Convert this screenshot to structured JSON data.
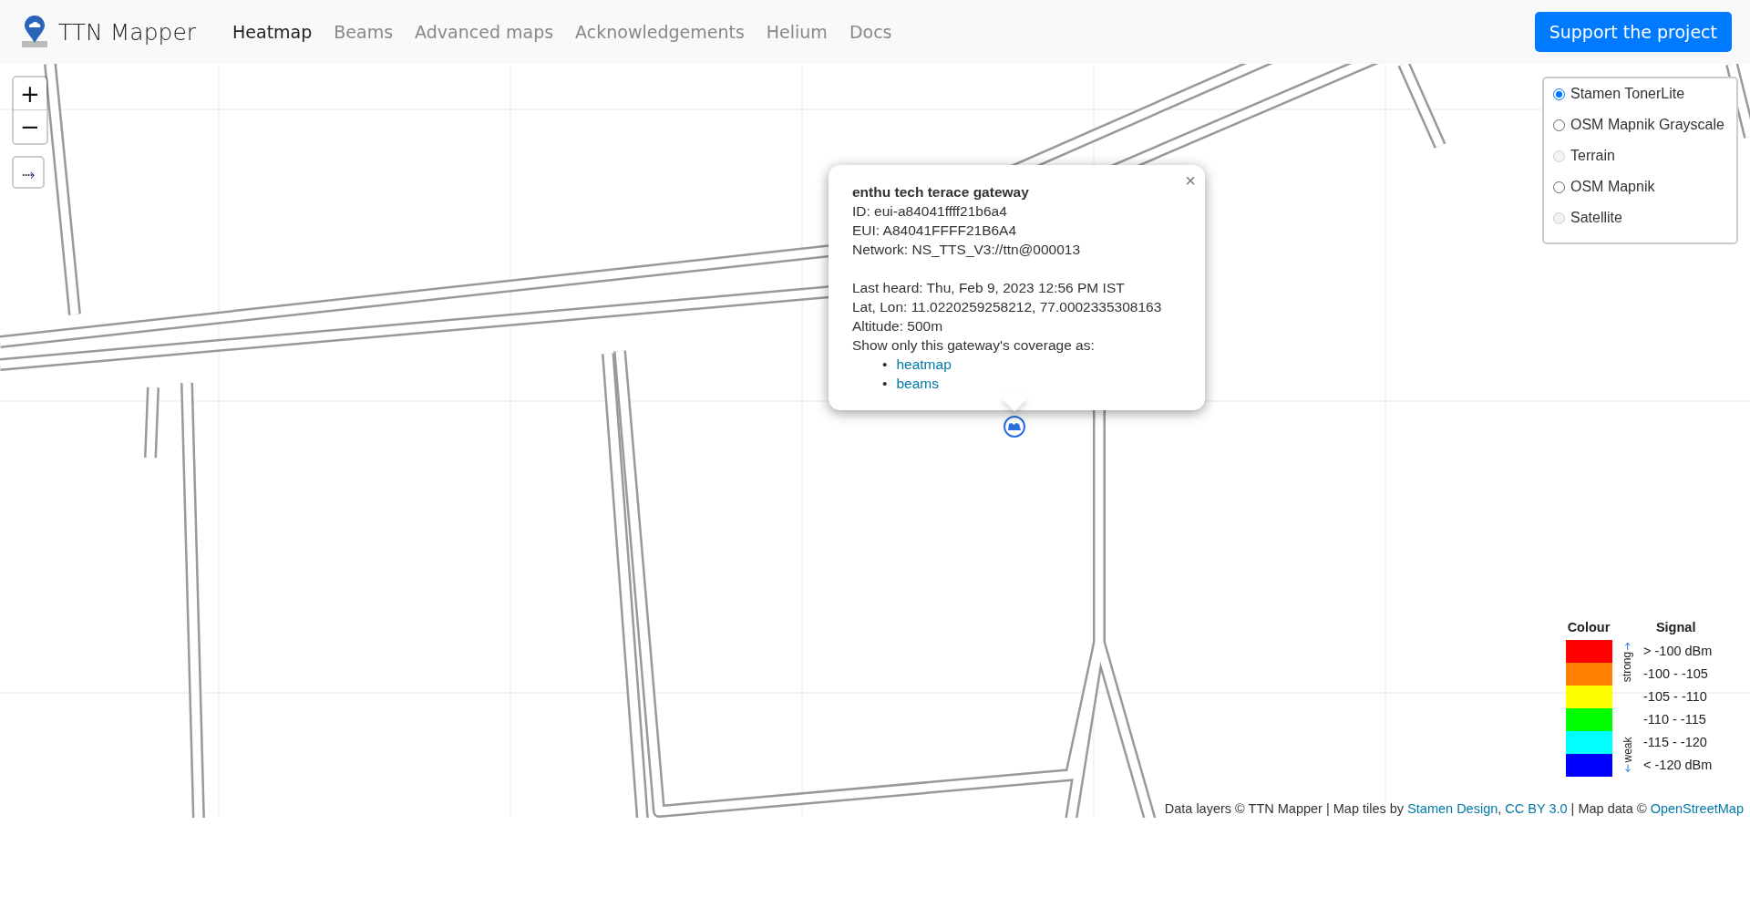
{
  "navbar": {
    "brand": "TTN Mapper",
    "items": [
      {
        "label": "Heatmap",
        "selected": true
      },
      {
        "label": "Beams",
        "selected": false
      },
      {
        "label": "Advanced maps",
        "selected": false
      },
      {
        "label": "Acknowledgements",
        "selected": false
      },
      {
        "label": "Helium",
        "selected": false
      },
      {
        "label": "Docs",
        "selected": false
      }
    ],
    "button": "Support the project"
  },
  "map": {
    "kind": "picture",
    "zoom_in": "+",
    "zoom_out": "−",
    "locate": "⤑",
    "popup": {
      "close": "×",
      "title": "enthu tech terace gateway",
      "sections": [
        [
          "ID: eui-a84041ffff21b6a4",
          "EUI: A84041FFFF21B6A4",
          "Network: NS_TTS_V3://ttn@000013"
        ],
        [
          "Last heard: Thu, Feb 9, 2023 12:56 PM IST",
          "Lat, Lon: 11.0220259258212, 77.0002335308163",
          "Altitude: 500m",
          "Show only this gateway's coverage as:"
        ]
      ],
      "links": [
        {
          "bullet": "•",
          "text": "heatmap"
        },
        {
          "bullet": "•",
          "text": "beams"
        }
      ]
    },
    "layers": [
      {
        "label": "Stamen TonerLite",
        "selected": true,
        "disabled": false
      },
      {
        "label": "OSM Mapnik Grayscale",
        "selected": false,
        "disabled": false
      },
      {
        "label": "Terrain",
        "selected": false,
        "disabled": true
      },
      {
        "label": "OSM Mapnik",
        "selected": false,
        "disabled": false
      },
      {
        "label": "Satellite",
        "selected": false,
        "disabled": true
      }
    ],
    "legend": {
      "colour_heading": "Colour",
      "signal_heading": "Signal",
      "strong": "strong",
      "weak": "weak",
      "items": [
        {
          "color": "#ff0000",
          "label": "> -100 dBm"
        },
        {
          "color": "#ff8000",
          "label": "-100 - -105"
        },
        {
          "color": "#ffff00",
          "label": "-105 - -110"
        },
        {
          "color": "#00ff00",
          "label": "-110 - -115"
        },
        {
          "color": "#00ffff",
          "label": "-115 - -120"
        },
        {
          "color": "#0000ff",
          "label": "< -120 dBm"
        }
      ]
    },
    "attribution": [
      {
        "kind": "text",
        "text": "Data layers © TTN Mapper | Map tiles by "
      },
      {
        "kind": "link",
        "text": "Stamen Design"
      },
      {
        "kind": "text",
        "text": ", "
      },
      {
        "kind": "link",
        "text": "CC BY 3.0"
      },
      {
        "kind": "text",
        "text": " | Map data © "
      },
      {
        "kind": "link",
        "text": "OpenStreetMap"
      }
    ]
  }
}
